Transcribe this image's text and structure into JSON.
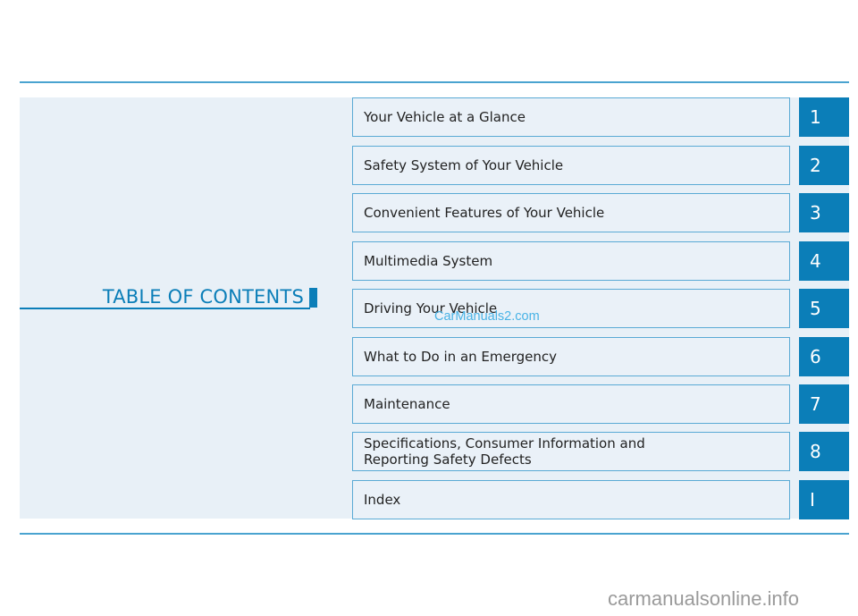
{
  "page": {
    "title": "TABLE OF CONTENTS",
    "accent_color": "#0b7eb8",
    "chapters": [
      {
        "number": "1",
        "label": "Your Vehicle at a Glance"
      },
      {
        "number": "2",
        "label": "Safety System of Your Vehicle"
      },
      {
        "number": "3",
        "label": "Convenient Features of Your Vehicle"
      },
      {
        "number": "4",
        "label": "Multimedia System"
      },
      {
        "number": "5",
        "label": "Driving Your Vehicle"
      },
      {
        "number": "6",
        "label": "What to Do in an Emergency"
      },
      {
        "number": "7",
        "label": "Maintenance"
      },
      {
        "number": "8",
        "label": "Specifications, Consumer Information and\nReporting Safety Defects"
      },
      {
        "number": "I",
        "label": "Index"
      }
    ]
  },
  "watermarks": {
    "inline": "CarManuals2.com",
    "footer": "carmanualsonline.info"
  }
}
